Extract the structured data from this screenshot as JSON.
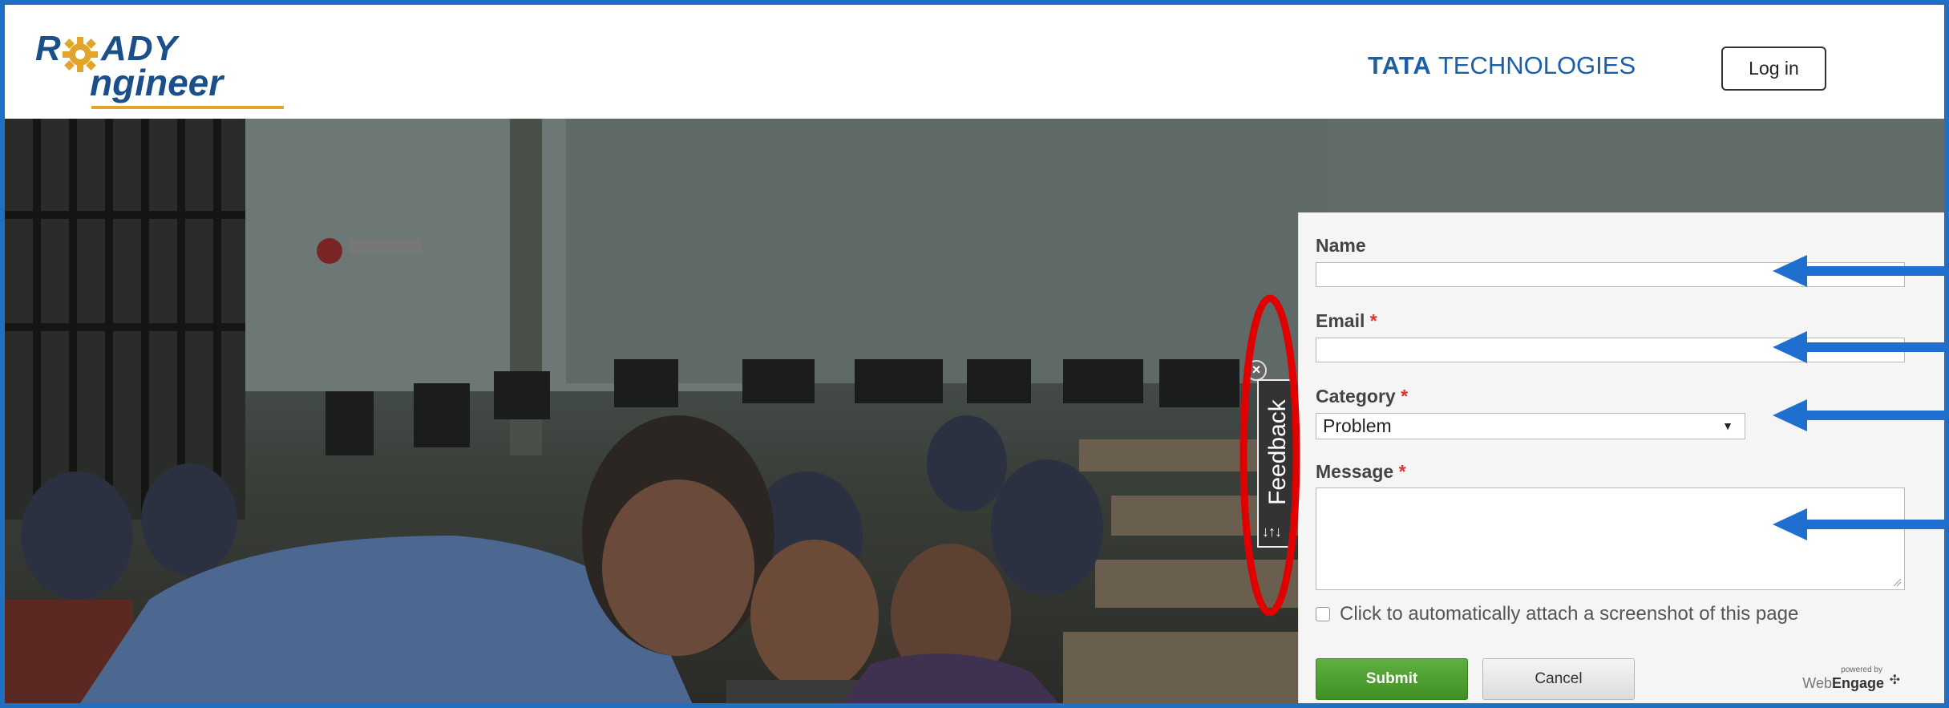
{
  "header": {
    "logo": {
      "r": "R",
      "ady": "ADY",
      "ngineer": "ngineer"
    },
    "brand": {
      "strong": "TATA",
      "rest": "TECHNOLOGIES"
    },
    "login_label": "Log in"
  },
  "feedback_tab": {
    "label": "Feedback",
    "arrows": "↓↑↓",
    "close": "×"
  },
  "form": {
    "name_label": "Name",
    "name_value": "",
    "email_label": "Email",
    "email_value": "",
    "required_mark": "*",
    "category_label": "Category",
    "category_value": "Problem",
    "message_label": "Message",
    "message_value": "",
    "screenshot_label": "Click to automatically attach a screenshot of this page",
    "screenshot_checked": false,
    "submit_label": "Submit",
    "cancel_label": "Cancel",
    "powered_small": "powered by",
    "powered_web": "Web",
    "powered_engage": "Engage"
  },
  "colors": {
    "frame": "#1f6fc4",
    "brand_blue": "#1a5fa8",
    "annotation_arrow": "#1e6fd0",
    "annotation_ellipse": "#e00000",
    "submit_green": "#4c9e2f"
  }
}
